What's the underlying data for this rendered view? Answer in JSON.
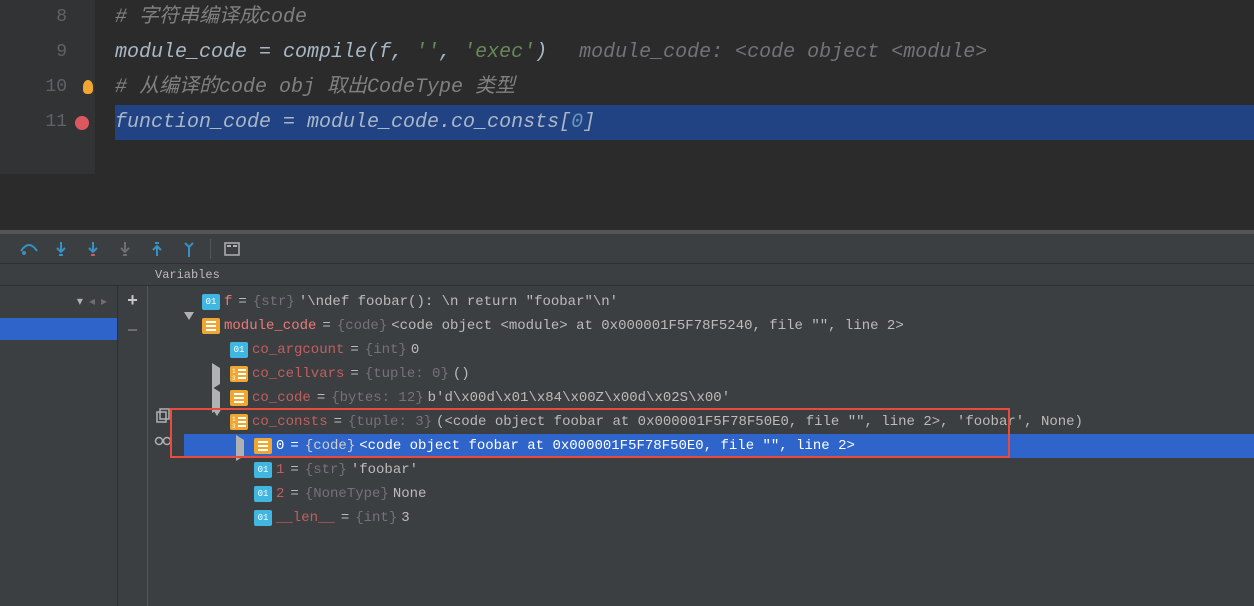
{
  "editor": {
    "lines": [
      "8",
      "9",
      "10",
      "11"
    ],
    "l8": "# 字符串编译成code",
    "l9_a": "module_code ",
    "l9_b": "= compile(f, ",
    "l9_c": "''",
    "l9_d": ", ",
    "l9_e": "'exec'",
    "l9_f": ")",
    "l9_hint": "module_code: <code object <module>",
    "l10": "# 从编译的code obj 取出CodeType 类型",
    "l11_a": "function_code = module_code.co_consts[",
    "l11_b": "0",
    "l11_c": "]"
  },
  "panel": {
    "var_header": "Variables"
  },
  "toolbar_icons": {
    "step_over": "step-over",
    "step_into": "step-into",
    "step_into_my": "step-into-my",
    "force_step": "force-step",
    "step_out": "step-out",
    "run_to_cursor": "run-to-cursor",
    "evaluate": "evaluate"
  },
  "vars": {
    "f_name": "f",
    "f_type": "{str}",
    "f_val": "'\\ndef foobar(): \\n    return \"foobar\"\\n'",
    "mc_name": "module_code",
    "mc_type": "{code}",
    "mc_val": "<code object <module> at 0x000001F5F78F5240, file \"\", line 2>",
    "arg_name": "co_argcount",
    "arg_type": "{int}",
    "arg_val": "0",
    "cell_name": "co_cellvars",
    "cell_type": "{tuple: 0}",
    "cell_val": "()",
    "code_name": "co_code",
    "code_type": "{bytes: 12}",
    "code_val": "b'd\\x00d\\x01\\x84\\x00Z\\x00d\\x02S\\x00'",
    "consts_name": "co_consts",
    "consts_type": "{tuple: 3}",
    "consts_val": "(<code object foobar at 0x000001F5F78F50E0, file \"\", line 2>, 'foobar', None)",
    "i0_name": "0",
    "i0_type": "{code}",
    "i0_val": "<code object foobar at 0x000001F5F78F50E0, file \"\", line 2>",
    "i1_name": "1",
    "i1_type": "{str}",
    "i1_val": "'foobar'",
    "i2_name": "2",
    "i2_type": "{NoneType}",
    "i2_val": "None",
    "len_name": "__len__",
    "len_type": "{int}",
    "len_val": "3"
  }
}
